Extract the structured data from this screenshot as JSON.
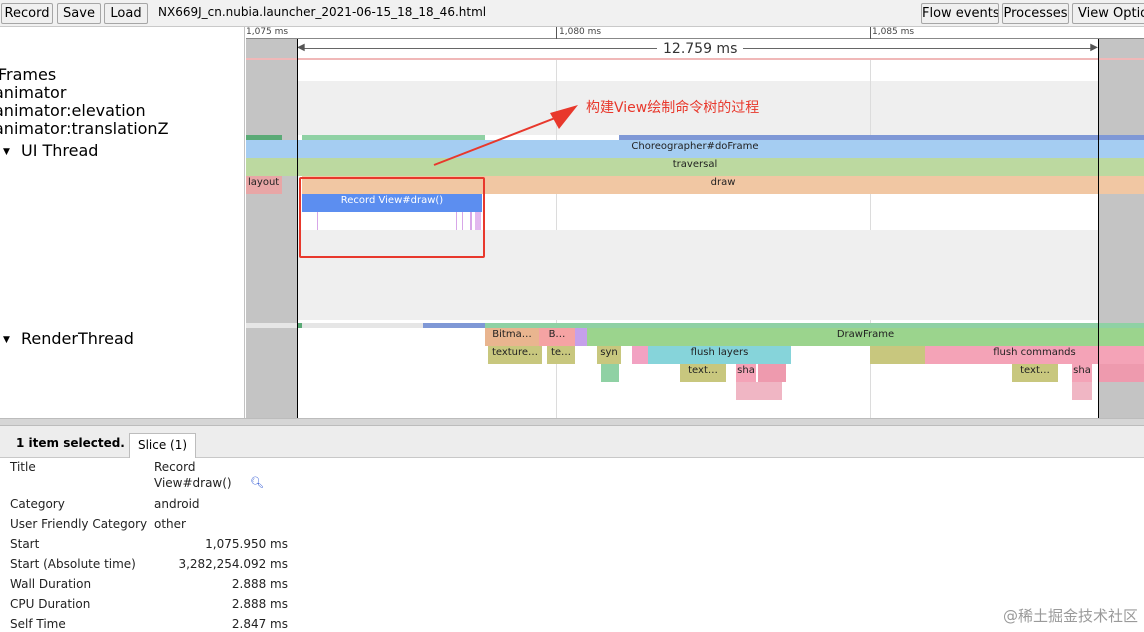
{
  "toolbar": {
    "record": "Record",
    "save": "Save",
    "load": "Load",
    "file_title": "NX669J_cn.nubia.launcher_2021-06-15_18_18_46.html",
    "flow_events": "Flow events",
    "processes": "Processes",
    "view_options": "View Options"
  },
  "tracks": {
    "frames": "Frames",
    "animator": "animator",
    "elevation": "animator:elevation",
    "translationz": "animator:translationZ",
    "ui_thread": "UI Thread",
    "render_thread": "RenderThread"
  },
  "ruler": {
    "tick1": "1,075 ms",
    "tick2": "1,080 ms",
    "tick3": "1,085 ms",
    "selection_duration": "12.759 ms"
  },
  "slices": {
    "choreographer": "Choreographer#doFrame",
    "traversal": "traversal",
    "layout": "layout",
    "draw": "draw",
    "record_view": "Record View#draw()",
    "bitmap": "Bitma…",
    "b": "B…",
    "drawframe": "DrawFrame",
    "texture1": "texture…",
    "te": "te…",
    "syn": "syn",
    "flush_layers": "flush layers",
    "flush_commands": "flush commands",
    "text1": "text…",
    "sha1": "sha",
    "text2": "text…",
    "sha2": "sha"
  },
  "annotation": "构建View绘制命令树的过程",
  "colors": {
    "annotation_red": "#e8382c",
    "selection_blue": "#5c8ef0"
  },
  "selection": {
    "count_label": "1 item selected.",
    "tab": "Slice (1)"
  },
  "details": {
    "title_key": "Title",
    "title_val1": "Record",
    "title_val2": "View#draw()",
    "category_key": "Category",
    "category_val": "android",
    "ufc_key": "User Friendly Category",
    "ufc_val": "other",
    "start_key": "Start",
    "start_val": "1,075.950 ms",
    "abs_key": "Start (Absolute time)",
    "abs_val": "3,282,254.092 ms",
    "wall_key": "Wall Duration",
    "wall_val": "2.888 ms",
    "cpu_key": "CPU Duration",
    "cpu_val": "2.888 ms",
    "self_key": "Self Time",
    "self_val": "2.847 ms"
  },
  "watermark": "@稀土掘金技术社区",
  "icons": {
    "search": "search-icon",
    "expand": "triangle-down-icon"
  }
}
